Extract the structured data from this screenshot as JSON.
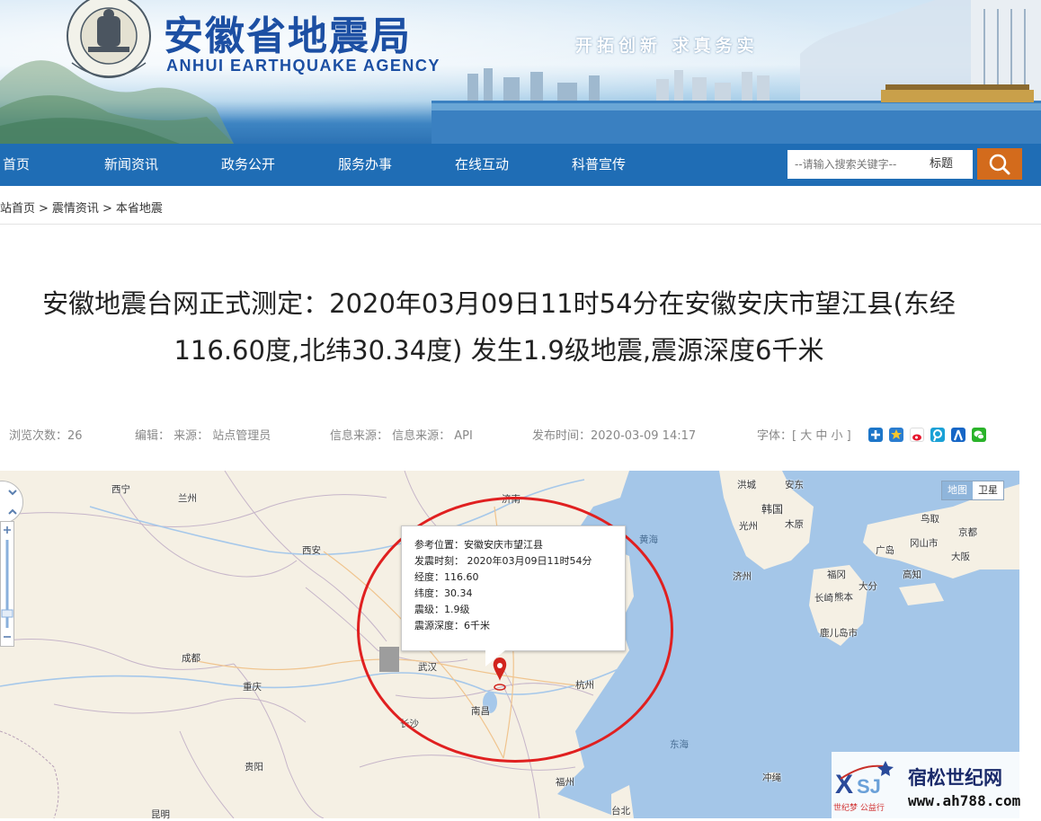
{
  "header": {
    "agency_cn": "安徽省地震局",
    "agency_en": "ANHUI EARTHQUAKE AGENCY",
    "emblem_text_outer": "CHINA EARTHQUAKE ADMINISTRATION",
    "emblem_text_inner": "中国地震局",
    "slogan": "开拓创新 求真务实"
  },
  "nav": {
    "items": [
      {
        "label": "首页"
      },
      {
        "label": "新闻资讯"
      },
      {
        "label": "政务公开"
      },
      {
        "label": "服务办事"
      },
      {
        "label": "在线互动"
      },
      {
        "label": "科普宣传"
      }
    ],
    "search": {
      "placeholder": "--请输入搜索关键字--",
      "type_label": "标题",
      "button_icon": "search-icon"
    }
  },
  "breadcrumb": {
    "items": [
      "站首页",
      "震情资讯",
      "本省地震"
    ],
    "separator": ">"
  },
  "article": {
    "title": "安徽地震台网正式测定：2020年03月09日11时54分在安徽安庆市望江县(东经116.60度,北纬30.34度) 发生1.9级地震,震源深度6千米",
    "meta": {
      "views": "浏览次数：26",
      "editor": "编辑： 来源： 站点管理员",
      "info_source": "信息来源： 信息来源： API",
      "published": "发布时间：2020-03-09 14:17",
      "font_size": "字体：[ 大 中 小 ]"
    },
    "share_icons": [
      "qzone-icon",
      "qq-friend-icon",
      "weibo-icon",
      "tencent-weibo-icon",
      "renren-icon",
      "wechat-icon"
    ]
  },
  "map": {
    "type_buttons": {
      "map": "地图",
      "satellite": "卫星"
    },
    "popup": {
      "location": "参考位置：安徽安庆市望江县",
      "time": "发震时刻： 2020年03月09日11时54分",
      "longitude": "经度：116.60",
      "latitude": "纬度：30.34",
      "magnitude": "震级：1.9级",
      "depth": "震源深度：6千米"
    },
    "cities": {
      "xining": "西宁",
      "lanzhou": "兰州",
      "xian": "西安",
      "chengdu": "成都",
      "chongqing": "重庆",
      "guiyang": "贵阳",
      "kunming": "昆明",
      "wuhan": "武汉",
      "changsha": "长沙",
      "nanchang": "南昌",
      "hangzhou": "杭州",
      "fuzhou": "福州",
      "taibei": "台北",
      "jinan": "济南",
      "hanguo": "韩国",
      "hongcheng": "洪城",
      "andong": "安东",
      "guangzhou_kr": "光州",
      "muyuan": "木原",
      "jizhou": "济州",
      "fugang": "福冈",
      "changqi": "长崎",
      "xiongben": "熊本",
      "dafen": "大分",
      "luerdao": "鹿儿岛市",
      "gaozhi": "高知",
      "gangshan": "冈山市",
      "guangdao": "广岛",
      "niaoqu": "鸟取",
      "jingdu": "京都",
      "daban": "大阪",
      "chongsheng": "冲绳"
    },
    "seas": {
      "huanghai": "黄海",
      "donghai": "东海"
    }
  },
  "watermark": {
    "site_name": "宿松世纪网",
    "url": "www.ah788.com",
    "tagline": "世纪梦 公益行",
    "logo_text": "XSJ"
  }
}
